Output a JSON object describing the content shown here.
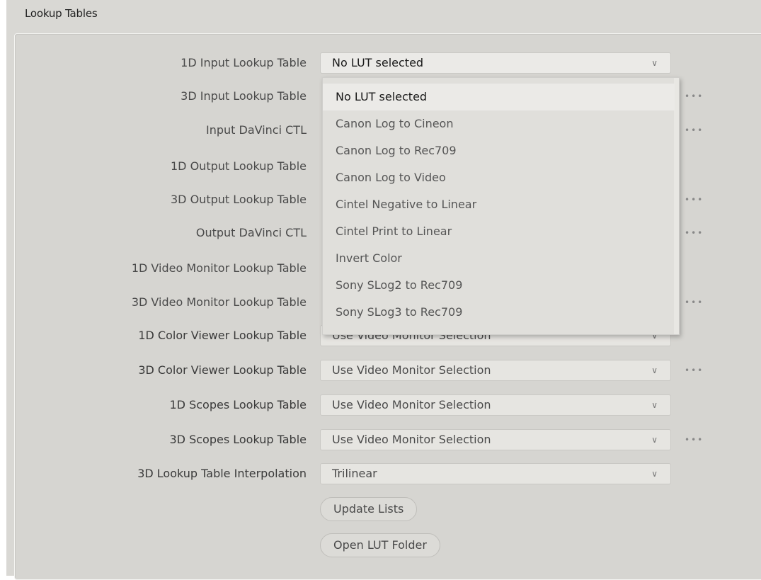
{
  "section": {
    "title": "Lookup Tables"
  },
  "rows": [
    {
      "label": "1D Input Lookup Table",
      "value": "No LUT selected",
      "has_dots": false
    },
    {
      "label": "3D Input Lookup Table",
      "value": "",
      "has_dots": true
    },
    {
      "label": "Input DaVinci CTL",
      "value": "",
      "has_dots": true
    },
    {
      "label": "1D Output Lookup Table",
      "value": "",
      "has_dots": false
    },
    {
      "label": "3D Output Lookup Table",
      "value": "",
      "has_dots": true
    },
    {
      "label": "Output DaVinci CTL",
      "value": "",
      "has_dots": true
    },
    {
      "label": "1D Video Monitor Lookup Table",
      "value": "",
      "has_dots": false
    },
    {
      "label": "3D Video Monitor Lookup Table",
      "value": "",
      "has_dots": true
    },
    {
      "label": "1D Color Viewer Lookup Table",
      "value": "Use Video Monitor Selection",
      "has_dots": false
    },
    {
      "label": "3D Color Viewer Lookup Table",
      "value": "Use Video Monitor Selection",
      "has_dots": true
    },
    {
      "label": "1D Scopes Lookup Table",
      "value": "Use Video Monitor Selection",
      "has_dots": false
    },
    {
      "label": "3D Scopes Lookup Table",
      "value": "Use Video Monitor Selection",
      "has_dots": true
    },
    {
      "label": "3D Lookup Table Interpolation",
      "value": "Trilinear",
      "has_dots": false
    }
  ],
  "dropdown": {
    "options": [
      "No LUT selected",
      "Canon Log to Cineon",
      "Canon Log to Rec709",
      "Canon Log to Video",
      "Cintel Negative to Linear",
      "Cintel Print to Linear",
      "Invert Color",
      "Sony SLog2 to Rec709",
      "Sony SLog3 to Rec709"
    ],
    "selected": "No LUT selected"
  },
  "buttons": {
    "update_lists": "Update Lists",
    "open_lut_folder": "Open LUT Folder"
  },
  "icons": {
    "chevron": "chevron-down-icon",
    "more": "more-dots-icon"
  },
  "colors": {
    "background": "#d6d5d1",
    "field": "#e6e5e1",
    "text": "#4a4a4a"
  }
}
